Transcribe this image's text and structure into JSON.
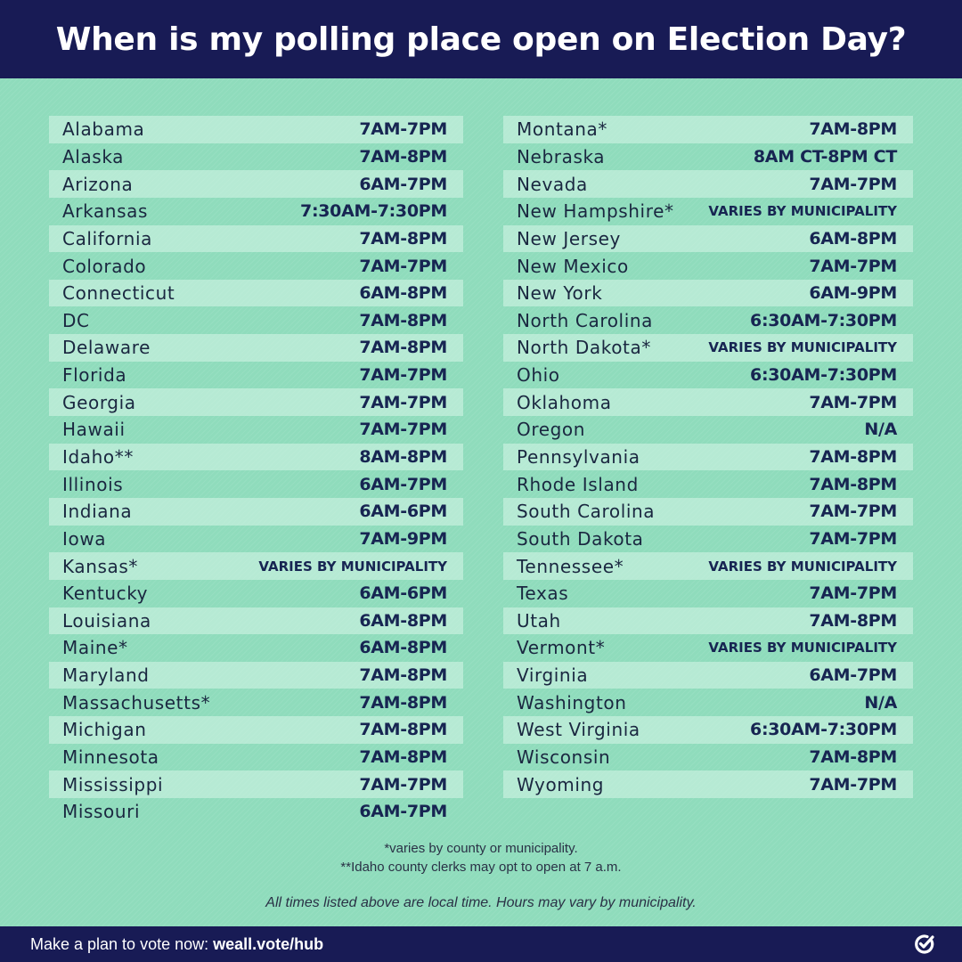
{
  "header": {
    "title": "When is my polling place open on Election Day?"
  },
  "left_column": [
    {
      "state": "Alabama",
      "hours": "7AM-7PM"
    },
    {
      "state": "Alaska",
      "hours": "7AM-8PM"
    },
    {
      "state": "Arizona",
      "hours": "6AM-7PM"
    },
    {
      "state": "Arkansas",
      "hours": "7:30AM-7:30PM"
    },
    {
      "state": "California",
      "hours": "7AM-8PM"
    },
    {
      "state": "Colorado",
      "hours": "7AM-7PM"
    },
    {
      "state": "Connecticut",
      "hours": "6AM-8PM"
    },
    {
      "state": "DC",
      "hours": "7AM-8PM"
    },
    {
      "state": "Delaware",
      "hours": "7AM-8PM"
    },
    {
      "state": "Florida",
      "hours": "7AM-7PM"
    },
    {
      "state": "Georgia",
      "hours": "7AM-7PM"
    },
    {
      "state": "Hawaii",
      "hours": "7AM-7PM"
    },
    {
      "state": "Idaho**",
      "hours": "8AM-8PM"
    },
    {
      "state": "Illinois",
      "hours": "6AM-7PM"
    },
    {
      "state": "Indiana",
      "hours": "6AM-6PM"
    },
    {
      "state": "Iowa",
      "hours": "7AM-9PM"
    },
    {
      "state": "Kansas*",
      "hours": "VARIES BY MUNICIPALITY"
    },
    {
      "state": "Kentucky",
      "hours": "6AM-6PM"
    },
    {
      "state": "Louisiana",
      "hours": "6AM-8PM"
    },
    {
      "state": "Maine*",
      "hours": "6AM-8PM"
    },
    {
      "state": "Maryland",
      "hours": "7AM-8PM"
    },
    {
      "state": "Massachusetts*",
      "hours": "7AM-8PM"
    },
    {
      "state": "Michigan",
      "hours": "7AM-8PM"
    },
    {
      "state": "Minnesota",
      "hours": "7AM-8PM"
    },
    {
      "state": "Mississippi",
      "hours": "7AM-7PM"
    },
    {
      "state": "Missouri",
      "hours": "6AM-7PM"
    }
  ],
  "right_column": [
    {
      "state": "Montana*",
      "hours": "7AM-8PM"
    },
    {
      "state": "Nebraska",
      "hours": "8AM CT-8PM CT"
    },
    {
      "state": "Nevada",
      "hours": "7AM-7PM"
    },
    {
      "state": "New Hampshire*",
      "hours": "VARIES BY MUNICIPALITY"
    },
    {
      "state": "New Jersey",
      "hours": "6AM-8PM"
    },
    {
      "state": "New Mexico",
      "hours": "7AM-7PM"
    },
    {
      "state": "New York",
      "hours": "6AM-9PM"
    },
    {
      "state": "North Carolina",
      "hours": "6:30AM-7:30PM"
    },
    {
      "state": "North Dakota*",
      "hours": "VARIES BY MUNICIPALITY"
    },
    {
      "state": "Ohio",
      "hours": "6:30AM-7:30PM"
    },
    {
      "state": "Oklahoma",
      "hours": "7AM-7PM"
    },
    {
      "state": "Oregon",
      "hours": "N/A"
    },
    {
      "state": "Pennsylvania",
      "hours": "7AM-8PM"
    },
    {
      "state": "Rhode Island",
      "hours": "7AM-8PM"
    },
    {
      "state": "South Carolina",
      "hours": "7AM-7PM"
    },
    {
      "state": "South Dakota",
      "hours": "7AM-7PM"
    },
    {
      "state": "Tennessee*",
      "hours": "VARIES BY MUNICIPALITY"
    },
    {
      "state": "Texas",
      "hours": "7AM-7PM"
    },
    {
      "state": "Utah",
      "hours": "7AM-8PM"
    },
    {
      "state": "Vermont*",
      "hours": "VARIES BY MUNICIPALITY"
    },
    {
      "state": "Virginia",
      "hours": "6AM-7PM"
    },
    {
      "state": "Washington",
      "hours": "N/A"
    },
    {
      "state": "West Virginia",
      "hours": "6:30AM-7:30PM"
    },
    {
      "state": "Wisconsin",
      "hours": "7AM-8PM"
    },
    {
      "state": "Wyoming",
      "hours": "7AM-7PM"
    }
  ],
  "notes": {
    "single_asterisk": "*varies by county or municipality.",
    "double_asterisk": "**Idaho county clerks may opt to open at 7 a.m.",
    "disclaimer": "All times listed above are local time. Hours may vary by municipality."
  },
  "footer": {
    "cta_text": "Make a plan to vote now: ",
    "link_text": "weall.vote/hub",
    "logo_icon": "check-circle-icon"
  },
  "colors": {
    "navy": "#181b55",
    "mint": "#8fdcbc",
    "text_dark": "#172552"
  }
}
